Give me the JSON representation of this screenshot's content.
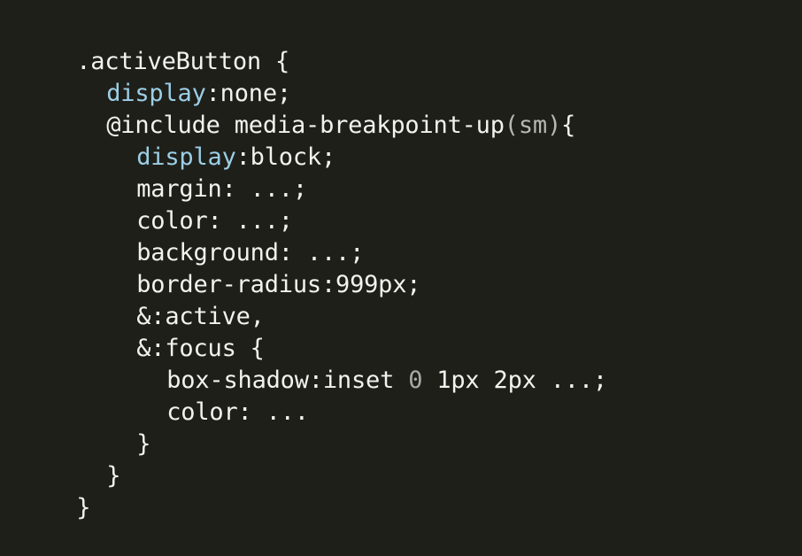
{
  "editor": {
    "lines": [
      {
        "indent": 0,
        "tokens": [
          {
            "text": ".activeButton {",
            "kind": "plain"
          }
        ]
      },
      {
        "indent": 1,
        "tokens": [
          {
            "text": "display",
            "kind": "prop"
          },
          {
            "text": ":none;",
            "kind": "plain"
          }
        ]
      },
      {
        "indent": 1,
        "tokens": [
          {
            "text": "@include media-breakpoint-up",
            "kind": "plain"
          },
          {
            "text": "(sm)",
            "kind": "paren"
          },
          {
            "text": "{",
            "kind": "plain"
          }
        ]
      },
      {
        "indent": 2,
        "tokens": [
          {
            "text": "display",
            "kind": "prop"
          },
          {
            "text": ":block;",
            "kind": "plain"
          }
        ]
      },
      {
        "indent": 2,
        "tokens": [
          {
            "text": "margin: ...;",
            "kind": "plain"
          }
        ]
      },
      {
        "indent": 2,
        "tokens": [
          {
            "text": "color: ...;",
            "kind": "plain"
          }
        ]
      },
      {
        "indent": 2,
        "tokens": [
          {
            "text": "background: ...;",
            "kind": "plain"
          }
        ]
      },
      {
        "indent": 2,
        "tokens": [
          {
            "text": "border-radius:999px;",
            "kind": "plain"
          }
        ]
      },
      {
        "indent": 2,
        "tokens": [
          {
            "text": "&:active,",
            "kind": "plain"
          }
        ]
      },
      {
        "indent": 2,
        "tokens": [
          {
            "text": "&:focus {",
            "kind": "plain"
          }
        ]
      },
      {
        "indent": 3,
        "tokens": [
          {
            "text": "box-shadow:inset ",
            "kind": "plain"
          },
          {
            "text": "0",
            "kind": "zero"
          },
          {
            "text": " 1px 2px ...;",
            "kind": "plain"
          }
        ]
      },
      {
        "indent": 3,
        "tokens": [
          {
            "text": "color: ...",
            "kind": "plain"
          }
        ]
      },
      {
        "indent": 2,
        "tokens": [
          {
            "text": "}",
            "kind": "plain"
          }
        ]
      },
      {
        "indent": 1,
        "tokens": [
          {
            "text": "}",
            "kind": "plain"
          }
        ]
      },
      {
        "indent": 0,
        "tokens": [
          {
            "text": "}",
            "kind": "plain"
          }
        ]
      }
    ]
  },
  "colors": {
    "background": "#1f1f1a",
    "text": "#f2f2ee",
    "property": "#9ccfe6",
    "paren": "#b8b8b2",
    "number_zero": "#a8a9a2"
  }
}
